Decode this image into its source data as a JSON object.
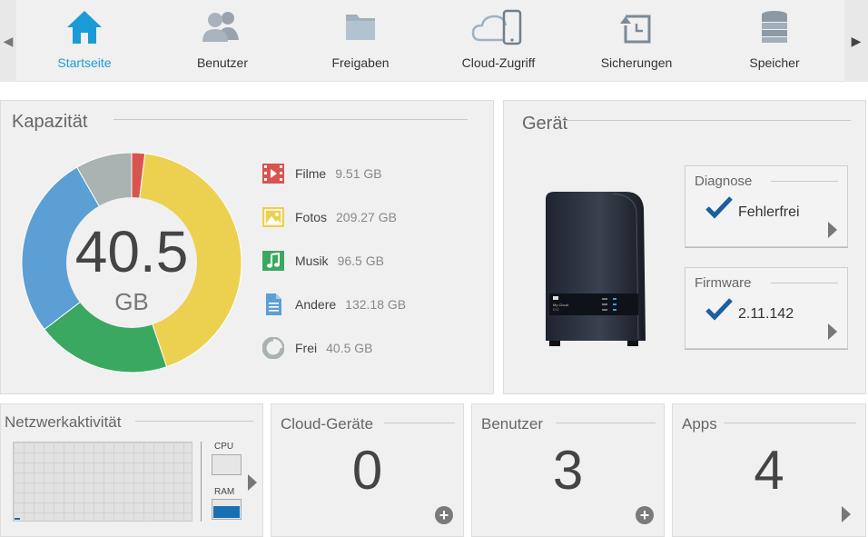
{
  "nav": {
    "items": [
      {
        "label": "Startseite",
        "icon": "home-icon",
        "active": true
      },
      {
        "label": "Benutzer",
        "icon": "users-icon"
      },
      {
        "label": "Freigaben",
        "icon": "folder-icon"
      },
      {
        "label": "Cloud-Zugriff",
        "icon": "cloud-device-icon"
      },
      {
        "label": "Sicherungen",
        "icon": "backup-icon"
      },
      {
        "label": "Speicher",
        "icon": "storage-icon"
      }
    ],
    "active_color": "#1a9bd7"
  },
  "capacity": {
    "title": "Kapazität",
    "free_value": "40.5",
    "free_unit": "GB",
    "legend": [
      {
        "name": "Filme",
        "value": "9.51 GB",
        "color": "#d9534f",
        "icon": "film-icon"
      },
      {
        "name": "Fotos",
        "value": "209.27 GB",
        "color": "#ecd04f",
        "icon": "photo-icon"
      },
      {
        "name": "Musik",
        "value": "96.5 GB",
        "color": "#3aa861",
        "icon": "music-icon"
      },
      {
        "name": "Andere",
        "value": "132.18 GB",
        "color": "#5b9fd4",
        "icon": "document-icon"
      },
      {
        "name": "Frei",
        "value": "40.5 GB",
        "color": "#aab2b2",
        "icon": "pie-icon"
      }
    ]
  },
  "device": {
    "title": "Gerät",
    "diagnose": {
      "title": "Diagnose",
      "value": "Fehlerfrei"
    },
    "firmware": {
      "title": "Firmware",
      "value": "2.11.142"
    },
    "nas_text": {
      "line1": "My Cloud",
      "line2": "EX2"
    }
  },
  "network": {
    "title": "Netzwerkaktivität",
    "cpu_label": "CPU",
    "ram_label": "RAM",
    "cpu_fraction": 0.0,
    "ram_fraction": 0.6
  },
  "cloud_devices": {
    "title": "Cloud-Geräte",
    "count": "0"
  },
  "users": {
    "title": "Benutzer",
    "count": "3"
  },
  "apps": {
    "title": "Apps",
    "count": "4"
  }
}
